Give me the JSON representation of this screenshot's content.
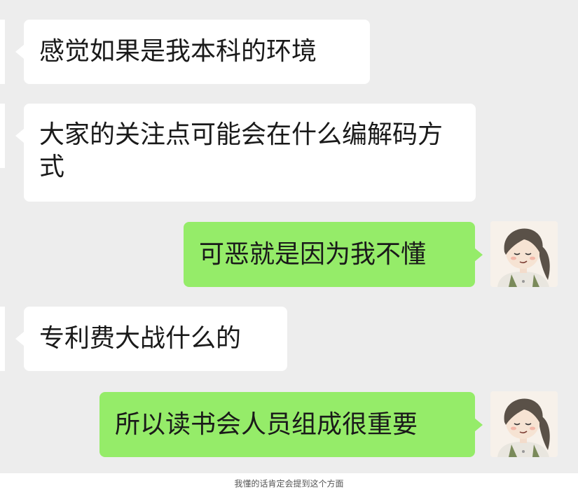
{
  "messages": [
    {
      "side": "received",
      "text": "感觉如果是我本科的环境"
    },
    {
      "side": "received",
      "text": "大家的关注点可能会在什么编解码方式"
    },
    {
      "side": "sent",
      "text": "可恶就是因为我不懂"
    },
    {
      "side": "received",
      "text": "专利费大战什么的"
    },
    {
      "side": "sent",
      "text": "所以读书会人员组成很重要"
    }
  ],
  "caption": "我懂的话肯定会提到这个方面",
  "colors": {
    "background": "#ededed",
    "received_bubble": "#ffffff",
    "sent_bubble": "#95ec69",
    "text": "#1a1a1a"
  },
  "icons": {
    "avatar": "cartoon-girl-avatar"
  }
}
